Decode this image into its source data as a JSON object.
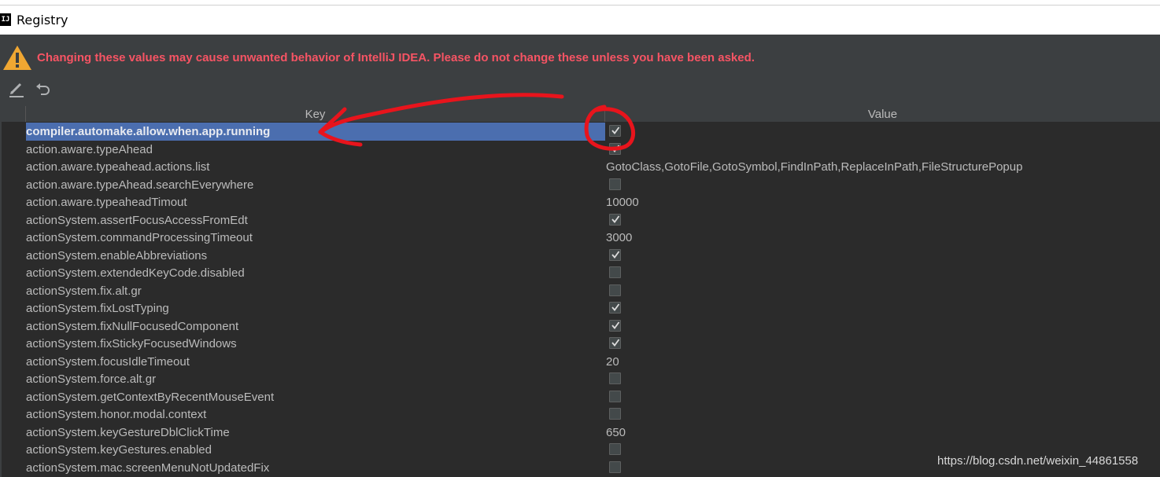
{
  "window": {
    "icon_label": "IJ",
    "title": "Registry"
  },
  "warning": {
    "icon": "warning-triangle-icon",
    "text": "Changing these values may cause unwanted behavior of IntelliJ IDEA. Please do not change these unless you have been asked."
  },
  "toolbar": {
    "edit_icon": "edit-pencil-icon",
    "revert_icon": "undo-icon"
  },
  "table": {
    "columns": {
      "key": "Key",
      "value": "Value"
    },
    "selected_row": 0,
    "rows": [
      {
        "key": "compiler.automake.allow.when.app.running",
        "type": "bool",
        "checked": true
      },
      {
        "key": "action.aware.typeAhead",
        "type": "bool",
        "checked": true
      },
      {
        "key": "action.aware.typeahead.actions.list",
        "type": "text",
        "value": "GotoClass,GotoFile,GotoSymbol,FindInPath,ReplaceInPath,FileStructurePopup"
      },
      {
        "key": "action.aware.typeAhead.searchEverywhere",
        "type": "bool",
        "checked": false
      },
      {
        "key": "action.aware.typeaheadTimout",
        "type": "text",
        "value": "10000"
      },
      {
        "key": "actionSystem.assertFocusAccessFromEdt",
        "type": "bool",
        "checked": true
      },
      {
        "key": "actionSystem.commandProcessingTimeout",
        "type": "text",
        "value": "3000"
      },
      {
        "key": "actionSystem.enableAbbreviations",
        "type": "bool",
        "checked": true
      },
      {
        "key": "actionSystem.extendedKeyCode.disabled",
        "type": "bool",
        "checked": false
      },
      {
        "key": "actionSystem.fix.alt.gr",
        "type": "bool",
        "checked": false
      },
      {
        "key": "actionSystem.fixLostTyping",
        "type": "bool",
        "checked": true
      },
      {
        "key": "actionSystem.fixNullFocusedComponent",
        "type": "bool",
        "checked": true
      },
      {
        "key": "actionSystem.fixStickyFocusedWindows",
        "type": "bool",
        "checked": true
      },
      {
        "key": "actionSystem.focusIdleTimeout",
        "type": "text",
        "value": "20"
      },
      {
        "key": "actionSystem.force.alt.gr",
        "type": "bool",
        "checked": false
      },
      {
        "key": "actionSystem.getContextByRecentMouseEvent",
        "type": "bool",
        "checked": false
      },
      {
        "key": "actionSystem.honor.modal.context",
        "type": "bool",
        "checked": false
      },
      {
        "key": "actionSystem.keyGestureDblClickTime",
        "type": "text",
        "value": "650"
      },
      {
        "key": "actionSystem.keyGestures.enabled",
        "type": "bool",
        "checked": false
      },
      {
        "key": "actionSystem.mac.screenMenuNotUpdatedFix",
        "type": "bool",
        "checked": false
      }
    ]
  },
  "watermark": "https://blog.csdn.net/weixin_44861558",
  "colors": {
    "background": "#3c3f41",
    "table_background": "#2b2b2b",
    "selection": "#4b6eaf",
    "warning_text": "#f75464",
    "annotation": "#e8141c"
  }
}
